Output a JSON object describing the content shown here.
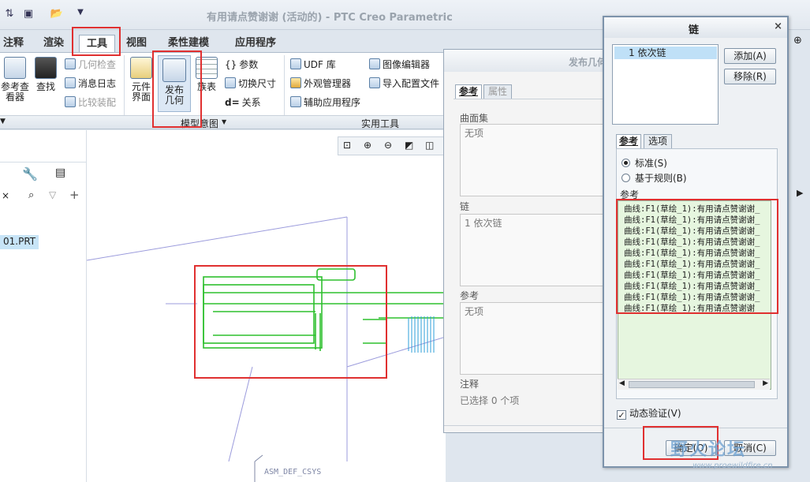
{
  "window": {
    "title": "有用请点赞谢谢 (活动的) - PTC Creo Parametric"
  },
  "tabs": [
    "注释",
    "渲染",
    "工具",
    "视图",
    "柔性建模",
    "应用程序"
  ],
  "active_tab": "工具",
  "ribbon": {
    "left_big": {
      "line1": "参考查",
      "line2": "看器"
    },
    "find": "查找",
    "geometry_check": "几何检查",
    "message_log": "消息日志",
    "compare_assembly": "比较装配",
    "component_interface": {
      "line1": "元件",
      "line2": "界面"
    },
    "publish_geometry": {
      "line1": "发布",
      "line2": "几何"
    },
    "family_table": "族表",
    "parameters": "参数",
    "switch_dimensions": "切换尺寸",
    "relations": "关系",
    "udf_library": "UDF 库",
    "appearance_manager": "外观管理器",
    "auxiliary_apps": "辅助应用程序",
    "image_editor": "图像编辑器",
    "import_config": "导入配置文件",
    "group_model_intent": "模型意图",
    "group_utilities": "实用工具"
  },
  "tree": {
    "item": "01.PRT"
  },
  "viewport": {
    "csys_label": "ASM_DEF_CSYS"
  },
  "publish_dialog": {
    "title": "发布几何",
    "tabs": [
      "参考",
      "属性"
    ],
    "surface_set_label": "曲面集",
    "surface_set_value": "无项",
    "chain_label": "链",
    "chain_value": "1 依次链",
    "ref_label": "参考",
    "ref_value": "无项",
    "note_label": "注释",
    "selected_text": "已选择 0 个项"
  },
  "chain_dialog": {
    "title": "链",
    "list_item": "1 依次链",
    "add_button": "添加(A)",
    "remove_button": "移除(R)",
    "tabs": [
      "参考",
      "选项"
    ],
    "radio_standard": "标准(S)",
    "radio_rule": "基于规则(B)",
    "ref_label": "参考",
    "ref_items": [
      "曲线:F1(草绘_1):有用请点赞谢谢_",
      "曲线:F1(草绘_1):有用请点赞谢谢_",
      "曲线:F1(草绘_1):有用请点赞谢谢_",
      "曲线:F1(草绘_1):有用请点赞谢谢_",
      "曲线:F1(草绘_1):有用请点赞谢谢_",
      "曲线:F1(草绘_1):有用请点赞谢谢_",
      "曲线:F1(草绘_1):有用请点赞谢谢_",
      "曲线:F1(草绘_1):有用请点赞谢谢_",
      "曲线:F1(草绘_1):有用请点赞谢谢_",
      "曲线:F1(草绘_1):有用请点赞谢谢_"
    ],
    "dynamic_verify": "动态验证(V)",
    "ok_button": "确定(O)",
    "cancel_button": "取消(C)"
  },
  "watermark": {
    "text": "野火论坛",
    "url": "www.proewildfire.cn"
  },
  "colors": {
    "highlight_red": "#e03030",
    "model_green": "#2ec02e",
    "ref_list_bg": "#e6f6df"
  }
}
